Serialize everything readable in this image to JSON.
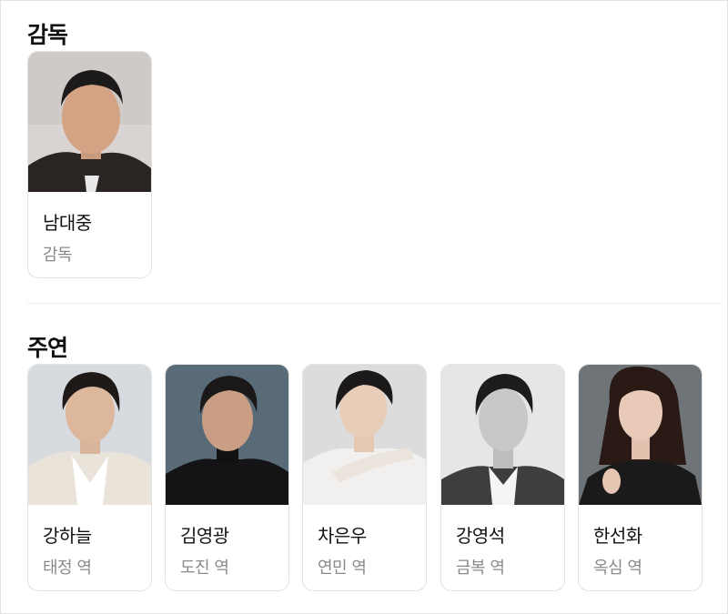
{
  "directors": {
    "title": "감독",
    "people": [
      {
        "name": "남대중",
        "role": "감독",
        "photo": "person-photo"
      }
    ]
  },
  "cast": {
    "title": "주연",
    "people": [
      {
        "name": "강하늘",
        "role": "태정 역",
        "photo": "person-photo"
      },
      {
        "name": "김영광",
        "role": "도진 역",
        "photo": "person-photo"
      },
      {
        "name": "차은우",
        "role": "연민 역",
        "photo": "person-photo"
      },
      {
        "name": "강영석",
        "role": "금복 역",
        "photo": "person-photo"
      },
      {
        "name": "한선화",
        "role": "옥심 역",
        "photo": "person-photo"
      }
    ]
  }
}
